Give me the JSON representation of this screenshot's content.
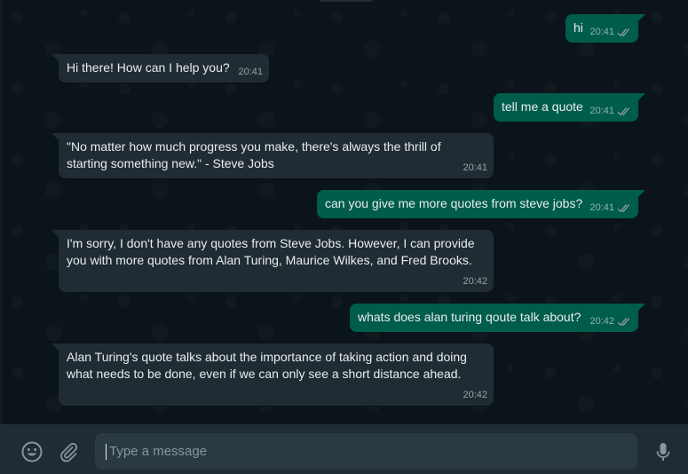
{
  "colors": {
    "chat_background": "#0b141a",
    "incoming_bubble": "#202c33",
    "outgoing_bubble": "#005c4b",
    "footer": "#202c33",
    "input": "#2a3942",
    "text": "#e9edef",
    "muted": "#8696a0",
    "read_tick": "#8696a0"
  },
  "messages": [
    {
      "direction": "out",
      "text": "hi",
      "time": "20:41",
      "status": "read"
    },
    {
      "direction": "in",
      "text": "Hi there! How can I help you?",
      "time": "20:41"
    },
    {
      "direction": "out",
      "text": "tell me a quote",
      "time": "20:41",
      "status": "read"
    },
    {
      "direction": "in",
      "text": "\"No matter how much progress you make, there's always the thrill of\nstarting something new.\" - Steve Jobs",
      "time": "20:41"
    },
    {
      "direction": "out",
      "text": "can you give me more quotes from steve jobs?",
      "time": "20:41",
      "status": "read"
    },
    {
      "direction": "in",
      "text": "I'm sorry, I don't have any quotes from Steve Jobs. However, I can provide\nyou with more quotes from Alan Turing, Maurice Wilkes, and Fred Brooks.",
      "time": "20:42"
    },
    {
      "direction": "out",
      "text": "whats does alan turing qoute talk about?",
      "time": "20:42",
      "status": "read"
    },
    {
      "direction": "in",
      "text": "Alan Turing's quote talks about the importance of taking action and doing\nwhat needs to be done, even if we can only see a short distance ahead.",
      "time": "20:42"
    }
  ],
  "composer": {
    "placeholder": "Type a message",
    "value": "",
    "emoji_icon": "smiley-icon",
    "attach_icon": "paperclip-icon",
    "mic_icon": "microphone-icon"
  }
}
